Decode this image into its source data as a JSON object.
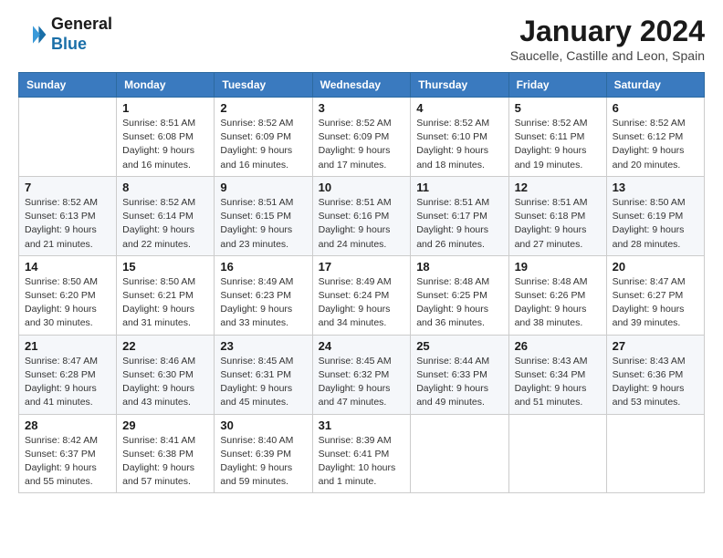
{
  "header": {
    "logo_line1": "General",
    "logo_line2": "Blue",
    "month": "January 2024",
    "location": "Saucelle, Castille and Leon, Spain"
  },
  "weekdays": [
    "Sunday",
    "Monday",
    "Tuesday",
    "Wednesday",
    "Thursday",
    "Friday",
    "Saturday"
  ],
  "weeks": [
    [
      {
        "day": "",
        "info": ""
      },
      {
        "day": "1",
        "info": "Sunrise: 8:51 AM\nSunset: 6:08 PM\nDaylight: 9 hours\nand 16 minutes."
      },
      {
        "day": "2",
        "info": "Sunrise: 8:52 AM\nSunset: 6:09 PM\nDaylight: 9 hours\nand 16 minutes."
      },
      {
        "day": "3",
        "info": "Sunrise: 8:52 AM\nSunset: 6:09 PM\nDaylight: 9 hours\nand 17 minutes."
      },
      {
        "day": "4",
        "info": "Sunrise: 8:52 AM\nSunset: 6:10 PM\nDaylight: 9 hours\nand 18 minutes."
      },
      {
        "day": "5",
        "info": "Sunrise: 8:52 AM\nSunset: 6:11 PM\nDaylight: 9 hours\nand 19 minutes."
      },
      {
        "day": "6",
        "info": "Sunrise: 8:52 AM\nSunset: 6:12 PM\nDaylight: 9 hours\nand 20 minutes."
      }
    ],
    [
      {
        "day": "7",
        "info": "Sunrise: 8:52 AM\nSunset: 6:13 PM\nDaylight: 9 hours\nand 21 minutes."
      },
      {
        "day": "8",
        "info": "Sunrise: 8:52 AM\nSunset: 6:14 PM\nDaylight: 9 hours\nand 22 minutes."
      },
      {
        "day": "9",
        "info": "Sunrise: 8:51 AM\nSunset: 6:15 PM\nDaylight: 9 hours\nand 23 minutes."
      },
      {
        "day": "10",
        "info": "Sunrise: 8:51 AM\nSunset: 6:16 PM\nDaylight: 9 hours\nand 24 minutes."
      },
      {
        "day": "11",
        "info": "Sunrise: 8:51 AM\nSunset: 6:17 PM\nDaylight: 9 hours\nand 26 minutes."
      },
      {
        "day": "12",
        "info": "Sunrise: 8:51 AM\nSunset: 6:18 PM\nDaylight: 9 hours\nand 27 minutes."
      },
      {
        "day": "13",
        "info": "Sunrise: 8:50 AM\nSunset: 6:19 PM\nDaylight: 9 hours\nand 28 minutes."
      }
    ],
    [
      {
        "day": "14",
        "info": "Sunrise: 8:50 AM\nSunset: 6:20 PM\nDaylight: 9 hours\nand 30 minutes."
      },
      {
        "day": "15",
        "info": "Sunrise: 8:50 AM\nSunset: 6:21 PM\nDaylight: 9 hours\nand 31 minutes."
      },
      {
        "day": "16",
        "info": "Sunrise: 8:49 AM\nSunset: 6:23 PM\nDaylight: 9 hours\nand 33 minutes."
      },
      {
        "day": "17",
        "info": "Sunrise: 8:49 AM\nSunset: 6:24 PM\nDaylight: 9 hours\nand 34 minutes."
      },
      {
        "day": "18",
        "info": "Sunrise: 8:48 AM\nSunset: 6:25 PM\nDaylight: 9 hours\nand 36 minutes."
      },
      {
        "day": "19",
        "info": "Sunrise: 8:48 AM\nSunset: 6:26 PM\nDaylight: 9 hours\nand 38 minutes."
      },
      {
        "day": "20",
        "info": "Sunrise: 8:47 AM\nSunset: 6:27 PM\nDaylight: 9 hours\nand 39 minutes."
      }
    ],
    [
      {
        "day": "21",
        "info": "Sunrise: 8:47 AM\nSunset: 6:28 PM\nDaylight: 9 hours\nand 41 minutes."
      },
      {
        "day": "22",
        "info": "Sunrise: 8:46 AM\nSunset: 6:30 PM\nDaylight: 9 hours\nand 43 minutes."
      },
      {
        "day": "23",
        "info": "Sunrise: 8:45 AM\nSunset: 6:31 PM\nDaylight: 9 hours\nand 45 minutes."
      },
      {
        "day": "24",
        "info": "Sunrise: 8:45 AM\nSunset: 6:32 PM\nDaylight: 9 hours\nand 47 minutes."
      },
      {
        "day": "25",
        "info": "Sunrise: 8:44 AM\nSunset: 6:33 PM\nDaylight: 9 hours\nand 49 minutes."
      },
      {
        "day": "26",
        "info": "Sunrise: 8:43 AM\nSunset: 6:34 PM\nDaylight: 9 hours\nand 51 minutes."
      },
      {
        "day": "27",
        "info": "Sunrise: 8:43 AM\nSunset: 6:36 PM\nDaylight: 9 hours\nand 53 minutes."
      }
    ],
    [
      {
        "day": "28",
        "info": "Sunrise: 8:42 AM\nSunset: 6:37 PM\nDaylight: 9 hours\nand 55 minutes."
      },
      {
        "day": "29",
        "info": "Sunrise: 8:41 AM\nSunset: 6:38 PM\nDaylight: 9 hours\nand 57 minutes."
      },
      {
        "day": "30",
        "info": "Sunrise: 8:40 AM\nSunset: 6:39 PM\nDaylight: 9 hours\nand 59 minutes."
      },
      {
        "day": "31",
        "info": "Sunrise: 8:39 AM\nSunset: 6:41 PM\nDaylight: 10 hours\nand 1 minute."
      },
      {
        "day": "",
        "info": ""
      },
      {
        "day": "",
        "info": ""
      },
      {
        "day": "",
        "info": ""
      }
    ]
  ]
}
